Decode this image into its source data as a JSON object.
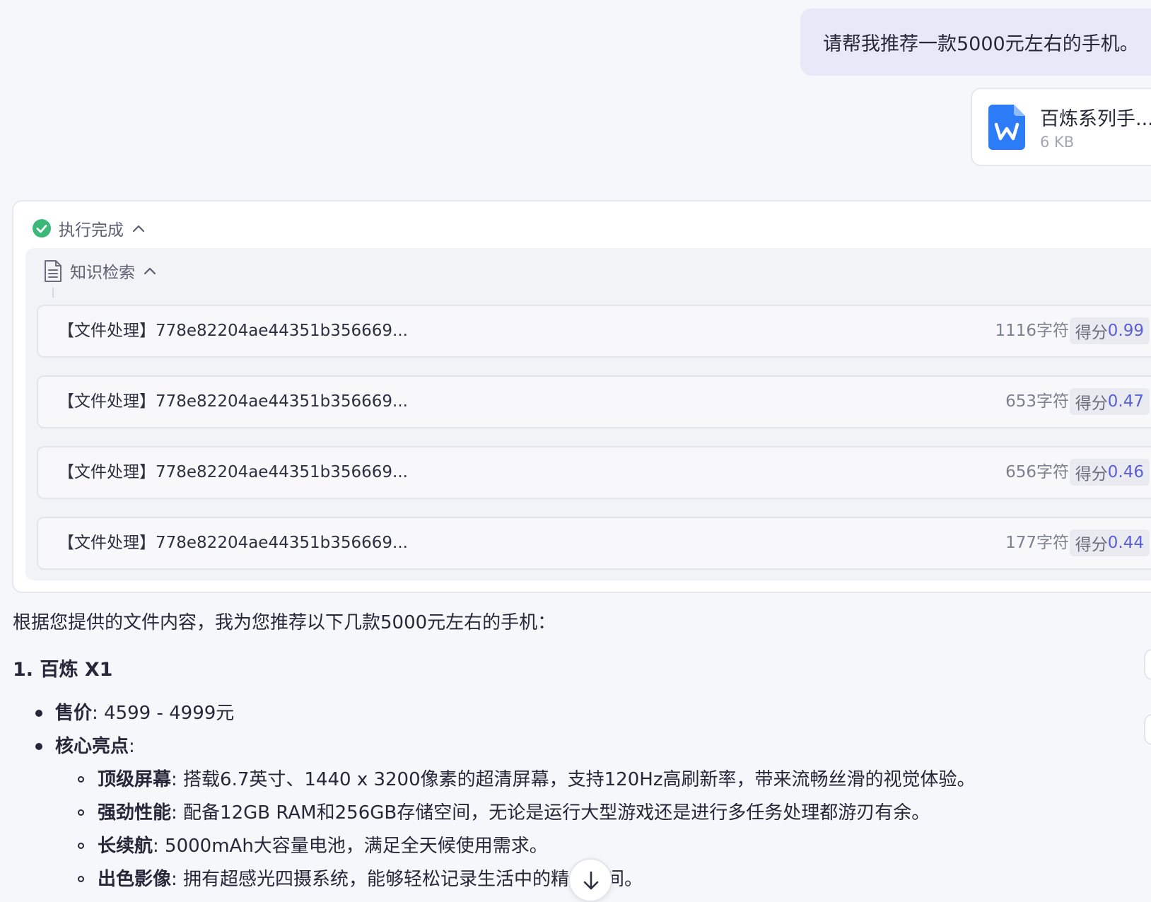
{
  "user_message": {
    "text": "请帮我推荐一款5000元左右的手机。"
  },
  "attachment": {
    "name": "百炼系列手...",
    "size": "6 KB",
    "icon": "word-document-icon",
    "icon_color": "#2b7cf6"
  },
  "execution": {
    "status": "执行完成",
    "status_icon": "check-circle-icon",
    "status_color": "#3cb879",
    "knowledge": {
      "title": "知识检索",
      "results": [
        {
          "title": "【文件处理】778e82204ae44351b356669...",
          "chars": "1116字符",
          "score_label": "得分",
          "score": "0.99"
        },
        {
          "title": "【文件处理】778e82204ae44351b356669...",
          "chars": "653字符",
          "score_label": "得分",
          "score": "0.47"
        },
        {
          "title": "【文件处理】778e82204ae44351b356669...",
          "chars": "656字符",
          "score_label": "得分",
          "score": "0.46"
        },
        {
          "title": "【文件处理】778e82204ae44351b356669...",
          "chars": "177字符",
          "score_label": "得分",
          "score": "0.44"
        }
      ]
    }
  },
  "answer": {
    "intro": "根据您提供的文件内容，我为您推荐以下几款5000元左右的手机：",
    "model_heading": "1. 百炼 X1",
    "price_label": "售价",
    "price_value": ": 4599 - 4999元",
    "highlights_label": "核心亮点",
    "highlights_colon": ":",
    "highlights": [
      {
        "label": "顶级屏幕",
        "text": ": 搭载6.7英寸、1440 x 3200像素的超清屏幕，支持120Hz高刷新率，带来流畅丝滑的视觉体验。"
      },
      {
        "label": "强劲性能",
        "text": ": 配备12GB RAM和256GB存储空间，无论是运行大型游戏还是进行多任务处理都游刃有余。"
      },
      {
        "label": "长续航",
        "text": ": 5000mAh大容量电池，满足全天候使用需求。"
      },
      {
        "label": "出色影像",
        "text": ": 拥有超感光四摄系统，能够轻松记录生活中的精彩瞬间。"
      }
    ]
  },
  "scroll_button": {
    "icon": "arrow-down-icon"
  }
}
